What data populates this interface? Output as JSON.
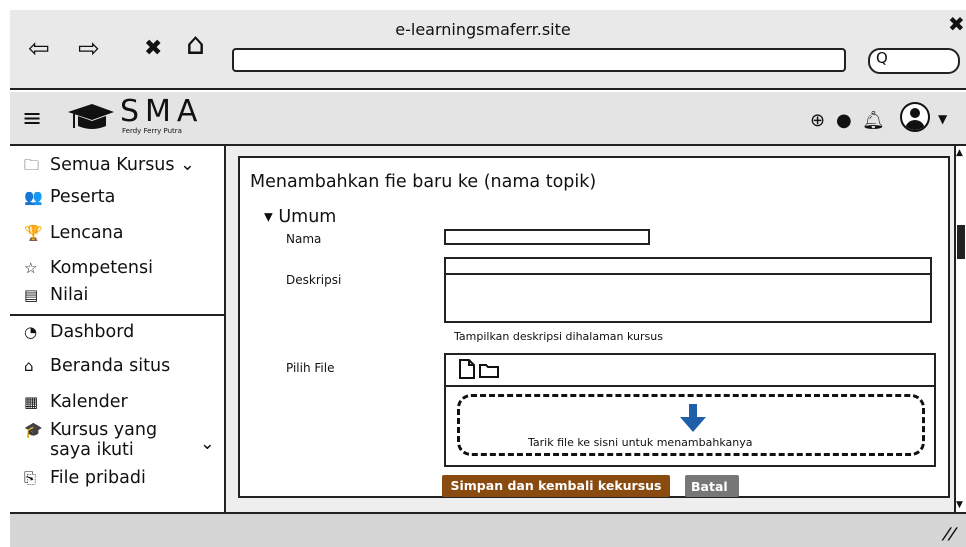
{
  "browser": {
    "url": "e-learningsmaferr.site",
    "back_icon": "⇦",
    "forward_icon": "⇨",
    "stop_icon": "✖",
    "home_icon": "⌂",
    "close_icon": "✖",
    "search_glyph": "Q"
  },
  "header": {
    "brand": "SMA",
    "brand_sub": "Ferdy Ferry Putra",
    "menu_icon": "≡",
    "globe_icon": "⊕",
    "chat_icon": "●",
    "bell_icon": "♫",
    "caret": "▼"
  },
  "sidebar": {
    "items": [
      {
        "icon": "🗀",
        "label": "Semua Kursus",
        "chevron": "⌄"
      },
      {
        "icon": "👥",
        "label": "Peserta"
      },
      {
        "icon": "🏆",
        "label": "Lencana"
      },
      {
        "icon": "☆",
        "label": "Kompetensi"
      },
      {
        "icon": "▤",
        "label": "Nilai"
      },
      {
        "icon": "◔",
        "label": "Dashbord"
      },
      {
        "icon": "⌂",
        "label": "Beranda situs"
      },
      {
        "icon": "▦",
        "label": "Kalender"
      },
      {
        "icon": "🎓",
        "label_line1": "Kursus yang",
        "label_line2": "saya ikuti",
        "chevron": "⌄"
      },
      {
        "icon": "⎘",
        "label": "File pribadi"
      }
    ]
  },
  "main": {
    "title": "Menambahkan fie baru ke (nama topik)",
    "section": "▾ Umum",
    "nama_label": "Nama",
    "deskripsi_label": "Deskripsi",
    "deskripsi_hint": "Tampilkan deskripsi dihalaman kursus",
    "pilih_file_label": "Pilih File",
    "drop_text": "Tarik file ke sisni untuk menambahkanya",
    "save_button": "Simpan dan kembali kekursus",
    "cancel_button": "Batal"
  },
  "colors": {
    "save_button": "#8a4b10",
    "cancel_button": "#777777",
    "arrow": "#1f5fa8"
  }
}
